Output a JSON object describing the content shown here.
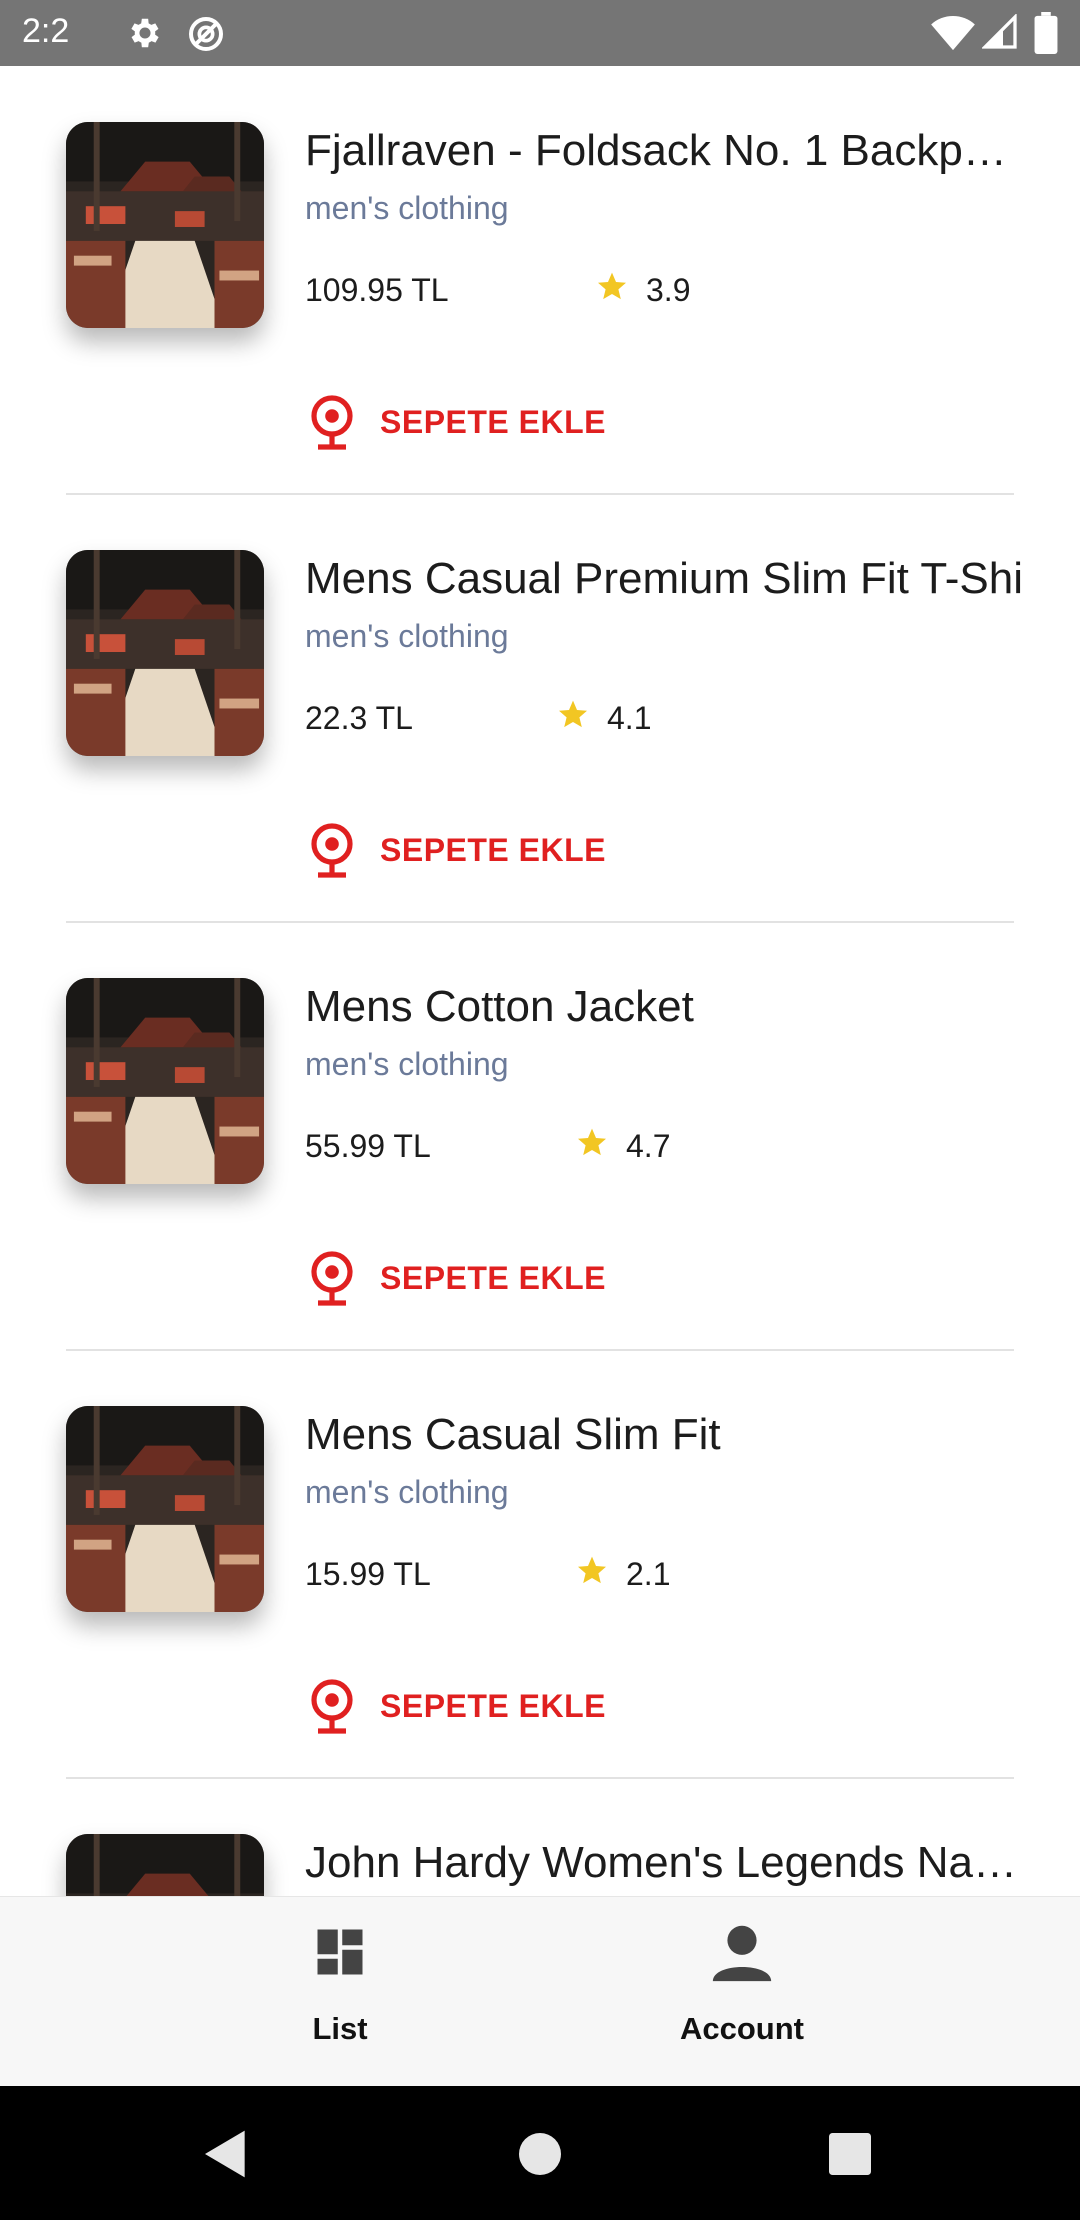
{
  "status_bar": {
    "time": "2:2",
    "icons": [
      "gear-icon",
      "sync-icon",
      "wifi-icon",
      "signal-icon",
      "battery-icon"
    ]
  },
  "products": [
    {
      "title": "Fjallraven - Foldsack No. 1 Backpac..",
      "category": "men's clothing",
      "price": "109.95 TL",
      "rating": "3.9",
      "cart_label": "SEPETE EKLE"
    },
    {
      "title": "Mens Casual Premium Slim Fit T-Shi",
      "category": "men's clothing",
      "price": "22.3 TL",
      "rating": "4.1",
      "cart_label": "SEPETE EKLE"
    },
    {
      "title": "Mens Cotton Jacket",
      "category": "men's clothing",
      "price": "55.99 TL",
      "rating": "4.7",
      "cart_label": "SEPETE EKLE"
    },
    {
      "title": "Mens Casual Slim Fit",
      "category": "men's clothing",
      "price": "15.99 TL",
      "rating": "2.1",
      "cart_label": "SEPETE EKLE"
    },
    {
      "title": "John Hardy Women's Legends Nag...",
      "category": "",
      "price": "",
      "rating": "",
      "cart_label": ""
    }
  ],
  "bottom_nav": {
    "items": [
      {
        "label": "List",
        "icon": "dashboard-icon"
      },
      {
        "label": "Account",
        "icon": "person-icon"
      }
    ]
  },
  "system_nav": {
    "icons": [
      "back-icon",
      "home-icon",
      "recents-icon"
    ]
  },
  "colors": {
    "status_bar": "#757575",
    "accent_red": "#e02020",
    "category_text": "#6b7a99",
    "star": "#f2c623",
    "nav_background": "#f7f7f7"
  }
}
